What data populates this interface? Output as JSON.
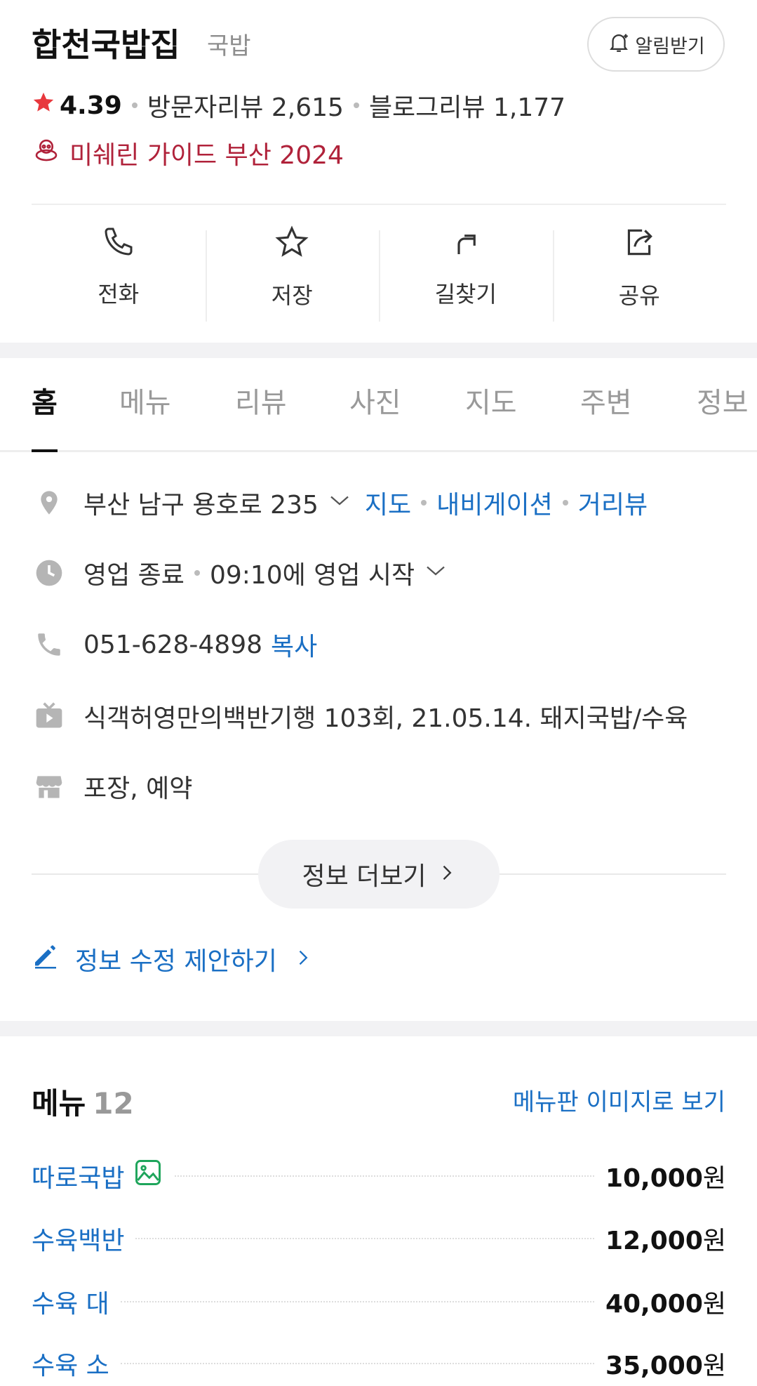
{
  "header": {
    "title": "합천국밥집",
    "category": "국밥",
    "notify_label": "알림받기",
    "rating": "4.39",
    "visitor_reviews": "방문자리뷰 2,615",
    "blog_reviews": "블로그리뷰 1,177",
    "michelin": "미쉐린 가이드 부산 2024"
  },
  "actions": [
    {
      "label": "전화",
      "icon": "phone-icon"
    },
    {
      "label": "저장",
      "icon": "star-outline-icon"
    },
    {
      "label": "길찾기",
      "icon": "directions-icon"
    },
    {
      "label": "공유",
      "icon": "share-icon"
    }
  ],
  "tabs": [
    "홈",
    "메뉴",
    "리뷰",
    "사진",
    "지도",
    "주변",
    "정보"
  ],
  "info": {
    "address": "부산 남구 용호로 235",
    "map_link": "지도",
    "navi_link": "내비게이션",
    "street_link": "거리뷰",
    "status": "영업 종료",
    "hours": "09:10에 영업 시작",
    "phone": "051-628-4898",
    "copy_label": "복사",
    "tv": "식객허영만의백반기행 103회, 21.05.14. 돼지국밥/수육",
    "services": "포장, 예약",
    "more_label": "정보 더보기",
    "suggest_label": "정보 수정 제안하기"
  },
  "menu": {
    "title": "메뉴",
    "count": "12",
    "image_link": "메뉴판 이미지로 보기",
    "items": [
      {
        "name": "따로국밥",
        "price": "10,000",
        "unit": "원",
        "has_photo": true
      },
      {
        "name": "수육백반",
        "price": "12,000",
        "unit": "원"
      },
      {
        "name": "수육 대",
        "price": "40,000",
        "unit": "원"
      },
      {
        "name": "수육 소",
        "price": "35,000",
        "unit": "원"
      }
    ]
  },
  "colors": {
    "link": "#1a6fc4",
    "michelin": "#b0223a",
    "star": "#e8383d",
    "photo_icon": "#1ea55b"
  }
}
